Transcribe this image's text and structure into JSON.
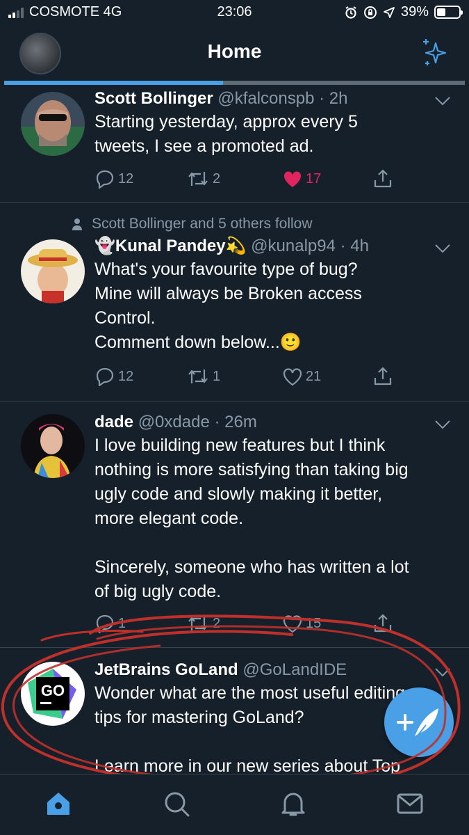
{
  "status": {
    "carrier": "COSMOTE 4G",
    "time": "23:06",
    "battery": "39%",
    "battery_level": 0.39
  },
  "header": {
    "title": "Home",
    "sparkle_icon": "sparkle-icon"
  },
  "tweets": [
    {
      "name": "Scott Bollinger",
      "handle": "@kfalconspb",
      "time": "· 2h",
      "text": "Starting yesterday, approx every 5\ntweets, I see a promoted ad.",
      "replies": "12",
      "retweets": "2",
      "likes": "17",
      "liked": true
    },
    {
      "social_context": "Scott Bollinger and 5 others follow",
      "name_prefix": "👻",
      "name": "Kunal Pandey",
      "name_suffix": "💫",
      "handle": "@kunalp94",
      "time": "· 4h",
      "text": "What's your favourite type of bug?\nMine will always be Broken access\nControl.\nComment down below...🙂",
      "replies": "12",
      "retweets": "1",
      "likes": "21",
      "liked": false
    },
    {
      "name": "dade",
      "handle": "@0xdade",
      "time": "· 26m",
      "text": "I love building new features but I think\nnothing is more satisfying than taking big\nugly code and slowly making it better,\nmore elegant code.\n\nSincerely, someone who has written a lot\nof big ugly code.",
      "replies": "1",
      "retweets": "2",
      "likes": "15",
      "liked": false
    },
    {
      "name": "JetBrains GoLand",
      "handle": "@GoLandIDE",
      "time": "",
      "text": "Wonder what are the most useful editing\ntips for mastering GoLand?\n\nLearn more in our new series about Top",
      "avatar_text": "GO"
    }
  ],
  "colors": {
    "background": "#15202b",
    "accent": "#4aa0e6",
    "like": "#e0245e",
    "muted": "#8899a6",
    "annotation": "#c0302a"
  }
}
